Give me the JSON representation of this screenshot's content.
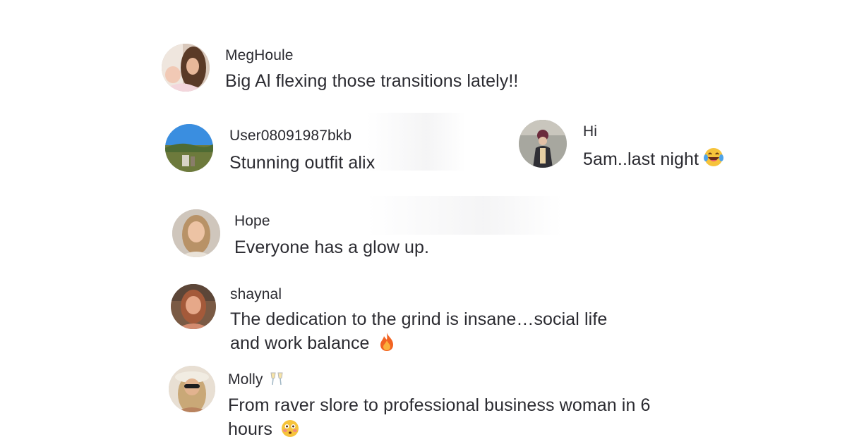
{
  "comments": [
    {
      "username": "MegHoule",
      "text": "Big Al flexing those transitions lately!!",
      "avatar_icon": "profile-photo"
    },
    {
      "username": "User08091987bkb",
      "text": "Stunning outfit alix",
      "avatar_icon": "profile-photo"
    },
    {
      "username": "Hi",
      "text": "5am..last night",
      "avatar_icon": "profile-photo",
      "emoji": "laughing-tears-emoji"
    },
    {
      "username": "Hope",
      "text": "Everyone has a glow up.",
      "avatar_icon": "profile-photo"
    },
    {
      "username": "shaynal",
      "text": "The dedication to the grind is insane…social life and work balance",
      "avatar_icon": "profile-photo",
      "emoji": "fire-emoji"
    },
    {
      "username": "Molly",
      "username_emoji": "clinking-glasses-emoji",
      "text": "From raver slore to professional business woman in 6 hours",
      "avatar_icon": "profile-photo",
      "emoji": "flushed-face-emoji"
    }
  ]
}
